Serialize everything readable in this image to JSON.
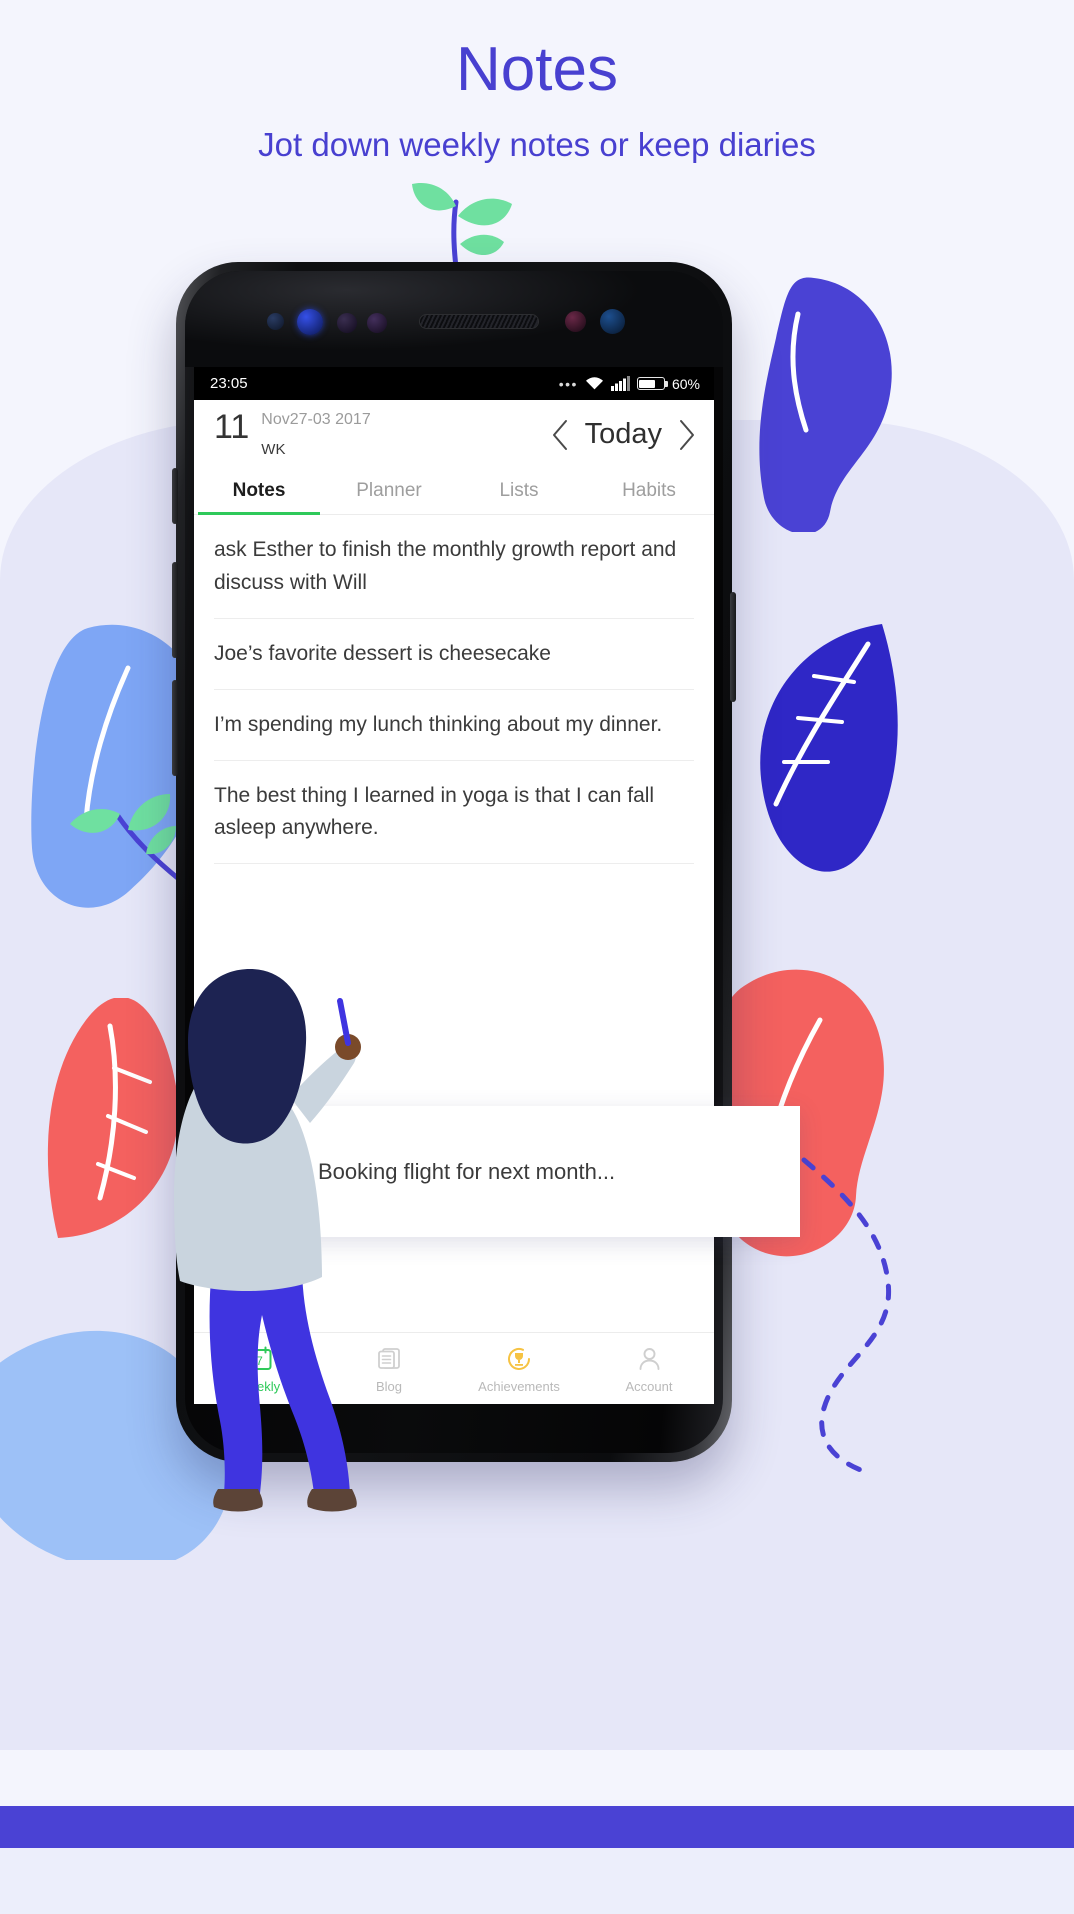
{
  "page": {
    "title": "Notes",
    "subtitle": "Jot down weekly notes or keep diaries",
    "accent_color": "#4840d0",
    "green_accent": "#2fc95a"
  },
  "phone": {
    "status_bar": {
      "time": "23:05",
      "more_icon": "overflow-dots-icon",
      "wifi_icon": "wifi-icon",
      "signal_icon": "cellular-signal-icon",
      "battery_icon": "battery-icon",
      "battery_percent": "60%"
    },
    "app_header": {
      "week_number": "11",
      "week_label": "WK",
      "date_range": "Nov27-03 2017",
      "prev_icon": "chevron-left-icon",
      "today_label": "Today",
      "next_icon": "chevron-right-icon"
    },
    "tabs": [
      {
        "label": "Notes",
        "active": true
      },
      {
        "label": "Planner",
        "active": false
      },
      {
        "label": "Lists",
        "active": false
      },
      {
        "label": "Habits",
        "active": false
      }
    ],
    "notes": [
      "ask Esther to finish the monthly growth report and discuss with Will",
      "Joe’s favorite dessert is cheesecake",
      "I’m spending my lunch thinking about my dinner.",
      "The best thing I learned in yoga is that I can fall asleep anywhere."
    ],
    "floating_card": {
      "text": "Booking flight for next month..."
    },
    "bottom_nav": [
      {
        "label": "Weekly",
        "icon": "calendar-7-icon",
        "active": true
      },
      {
        "label": "Blog",
        "icon": "articles-icon",
        "active": false
      },
      {
        "label": "Achievements",
        "icon": "trophy-icon",
        "active": false
      },
      {
        "label": "Account",
        "icon": "person-icon",
        "active": false
      }
    ]
  }
}
